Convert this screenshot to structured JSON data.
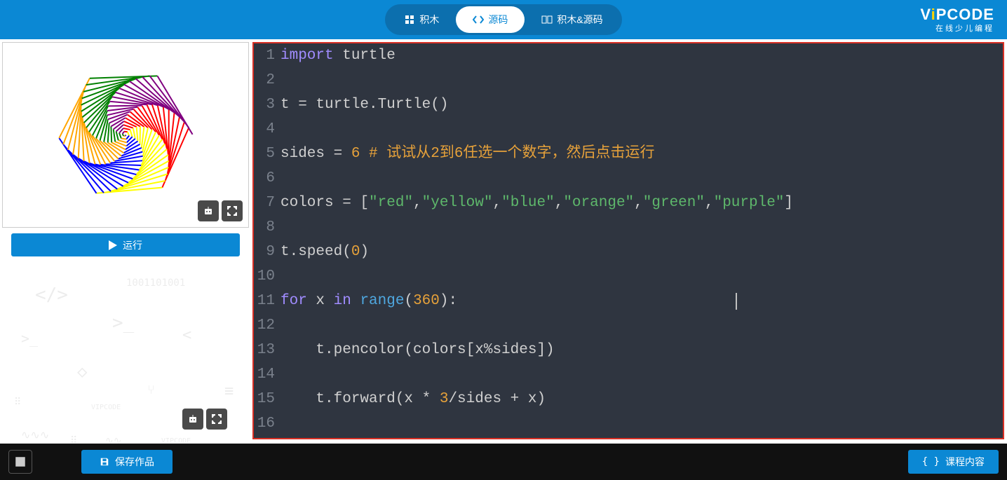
{
  "header": {
    "tabs": [
      {
        "label": "积木",
        "active": false
      },
      {
        "label": "源码",
        "active": true
      },
      {
        "label": "积木&源码",
        "active": false
      }
    ],
    "logo": {
      "brand_v": "V",
      "brand_i": "i",
      "brand_rest": "PCODE",
      "subtitle": "在线少儿编程"
    }
  },
  "preview": {
    "run_label": "运行",
    "colors": [
      "red",
      "yellow",
      "blue",
      "orange",
      "green",
      "purple"
    ]
  },
  "editor": {
    "lines": [
      {
        "n": 1,
        "tokens": [
          [
            "kw",
            "import"
          ],
          [
            "id",
            " turtle"
          ]
        ]
      },
      {
        "n": 2,
        "tokens": []
      },
      {
        "n": 3,
        "tokens": [
          [
            "id",
            "t "
          ],
          [
            "id",
            "= turtle.Turtle()"
          ]
        ]
      },
      {
        "n": 4,
        "tokens": []
      },
      {
        "n": 5,
        "tokens": [
          [
            "id",
            "sides = "
          ],
          [
            "num",
            "6"
          ],
          [
            "id",
            " "
          ],
          [
            "cmt",
            "# 试试从2到6任选一个数字，然后点击运行"
          ]
        ]
      },
      {
        "n": 6,
        "tokens": []
      },
      {
        "n": 7,
        "tokens": [
          [
            "id",
            "colors = ["
          ],
          [
            "str",
            "\"red\""
          ],
          [
            "id",
            ","
          ],
          [
            "str",
            "\"yellow\""
          ],
          [
            "id",
            ","
          ],
          [
            "str",
            "\"blue\""
          ],
          [
            "id",
            ","
          ],
          [
            "str",
            "\"orange\""
          ],
          [
            "id",
            ","
          ],
          [
            "str",
            "\"green\""
          ],
          [
            "id",
            ","
          ],
          [
            "str",
            "\"purple\""
          ],
          [
            "id",
            "]"
          ]
        ]
      },
      {
        "n": 8,
        "tokens": []
      },
      {
        "n": 9,
        "tokens": [
          [
            "id",
            "t.speed("
          ],
          [
            "num",
            "0"
          ],
          [
            "id",
            ")"
          ]
        ]
      },
      {
        "n": 10,
        "tokens": []
      },
      {
        "n": 11,
        "tokens": [
          [
            "kw",
            "for"
          ],
          [
            "id",
            " x "
          ],
          [
            "kw",
            "in"
          ],
          [
            "id",
            " "
          ],
          [
            "fn",
            "range"
          ],
          [
            "id",
            "("
          ],
          [
            "num",
            "360"
          ],
          [
            "id",
            "):"
          ]
        ]
      },
      {
        "n": 12,
        "tokens": []
      },
      {
        "n": 13,
        "tokens": [
          [
            "id",
            "    t.pencolor(colors[x%sides])"
          ]
        ]
      },
      {
        "n": 14,
        "tokens": []
      },
      {
        "n": 15,
        "tokens": [
          [
            "id",
            "    t.forward(x * "
          ],
          [
            "num",
            "3"
          ],
          [
            "id",
            "/sides + x)"
          ]
        ]
      },
      {
        "n": 16,
        "tokens": []
      }
    ]
  },
  "footer": {
    "save_label": "保存作品",
    "course_label": "课程内容",
    "course_icon": "{ }"
  },
  "decor_binary": "1001101001"
}
